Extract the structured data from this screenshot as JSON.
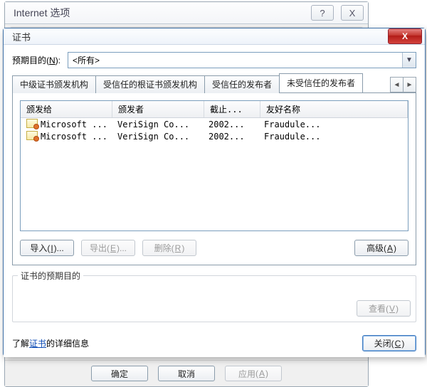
{
  "parent": {
    "title": "Internet 选项",
    "buttons": {
      "ok_label": "确定",
      "cancel_label": "取消",
      "apply_label": "应用",
      "apply_u": "A"
    }
  },
  "cert": {
    "title": "证书",
    "purpose": {
      "label_pre": "预期目的",
      "label_u": "N",
      "value": "<所有>"
    },
    "tabs": {
      "t1": "中级证书颁发机构",
      "t2": "受信任的根证书颁发机构",
      "t3": "受信任的发布者",
      "t4": "未受信任的发布者"
    },
    "columns": {
      "c1": "颁发给",
      "c2": "颁发者",
      "c3": "截止...",
      "c4": "友好名称"
    },
    "rows": [
      {
        "to": "Microsoft ...",
        "by": "VeriSign Co...",
        "exp": "2002...",
        "fn": "Fraudule..."
      },
      {
        "to": "Microsoft ...",
        "by": "VeriSign Co...",
        "exp": "2002...",
        "fn": "Fraudule..."
      }
    ],
    "buttons": {
      "import_label": "导入",
      "import_u": "I",
      "import_tail": "...",
      "export_label": "导出",
      "export_u": "E",
      "export_tail": "...",
      "remove_label": "删除",
      "remove_u": "R",
      "advanced_label": "高级",
      "advanced_u": "A",
      "view_label": "查看",
      "view_u": "V",
      "close_label": "关闭",
      "close_u": "C"
    },
    "purposes_caption": "证书的预期目的",
    "learn_pre": "了解",
    "learn_link": "证书",
    "learn_post": "的详细信息"
  }
}
